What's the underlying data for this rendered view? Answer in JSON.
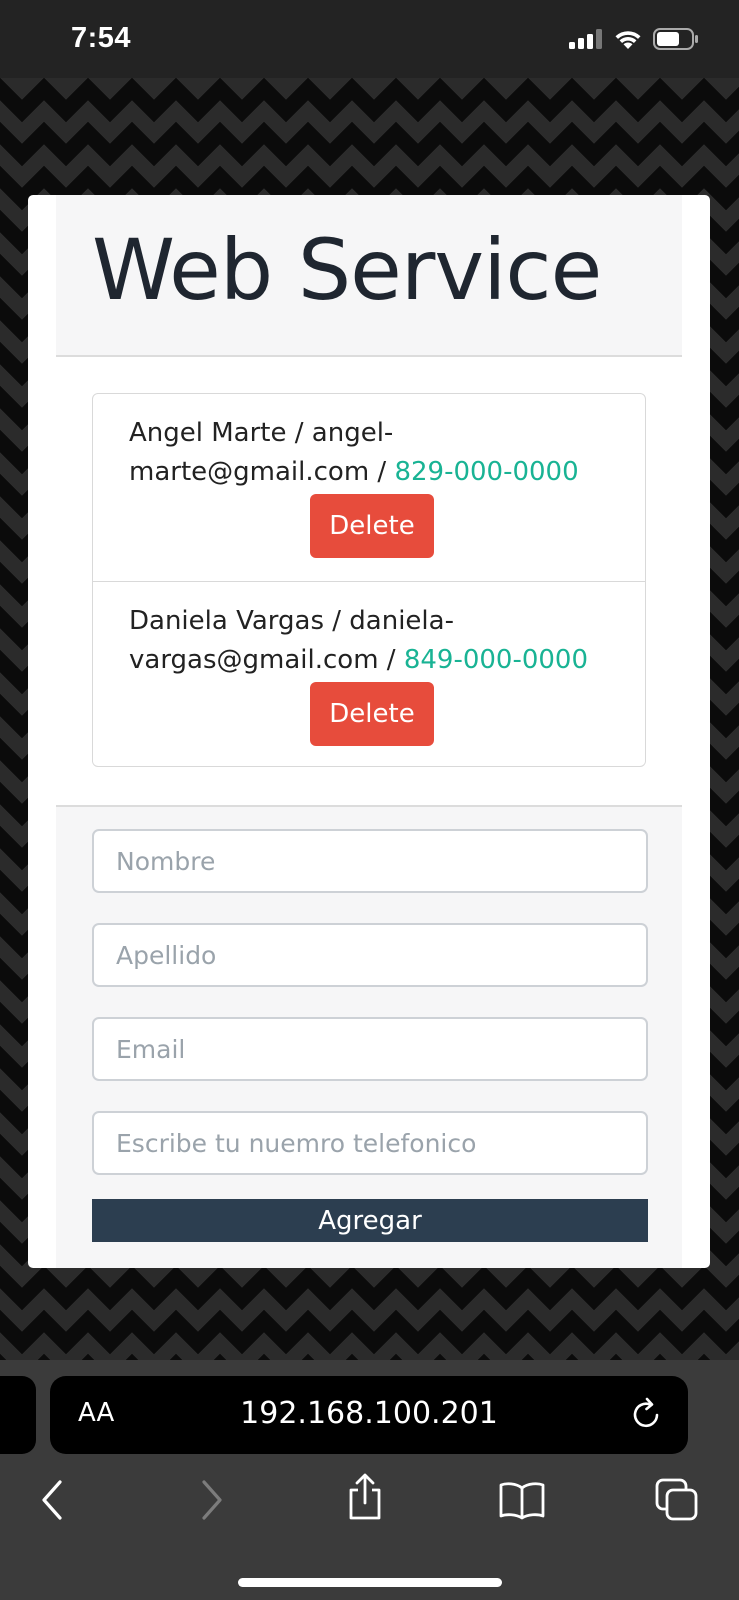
{
  "status": {
    "time": "7:54"
  },
  "page": {
    "title": "Web Service"
  },
  "contacts": [
    {
      "text": "Angel Marte / angel-marte@gmail.com / ",
      "phone": "829-000-0000",
      "delete_label": "Delete"
    },
    {
      "text": "Daniela Vargas / daniela-vargas@gmail.com / ",
      "phone": "849-000-0000",
      "delete_label": "Delete"
    }
  ],
  "form": {
    "nombre_placeholder": "Nombre",
    "apellido_placeholder": "Apellido",
    "email_placeholder": "Email",
    "telefono_placeholder": "Escribe tu nuemro telefonico",
    "submit_label": "Agregar"
  },
  "browser": {
    "aa_label": "AA",
    "url": "192.168.100.201",
    "icons": [
      "back-icon",
      "forward-icon",
      "share-icon",
      "bookmarks-icon",
      "tabs-icon",
      "reload-icon"
    ]
  },
  "colors": {
    "delete": "#e74c3c",
    "submit": "#2c3e50",
    "phone": "#19b394"
  }
}
